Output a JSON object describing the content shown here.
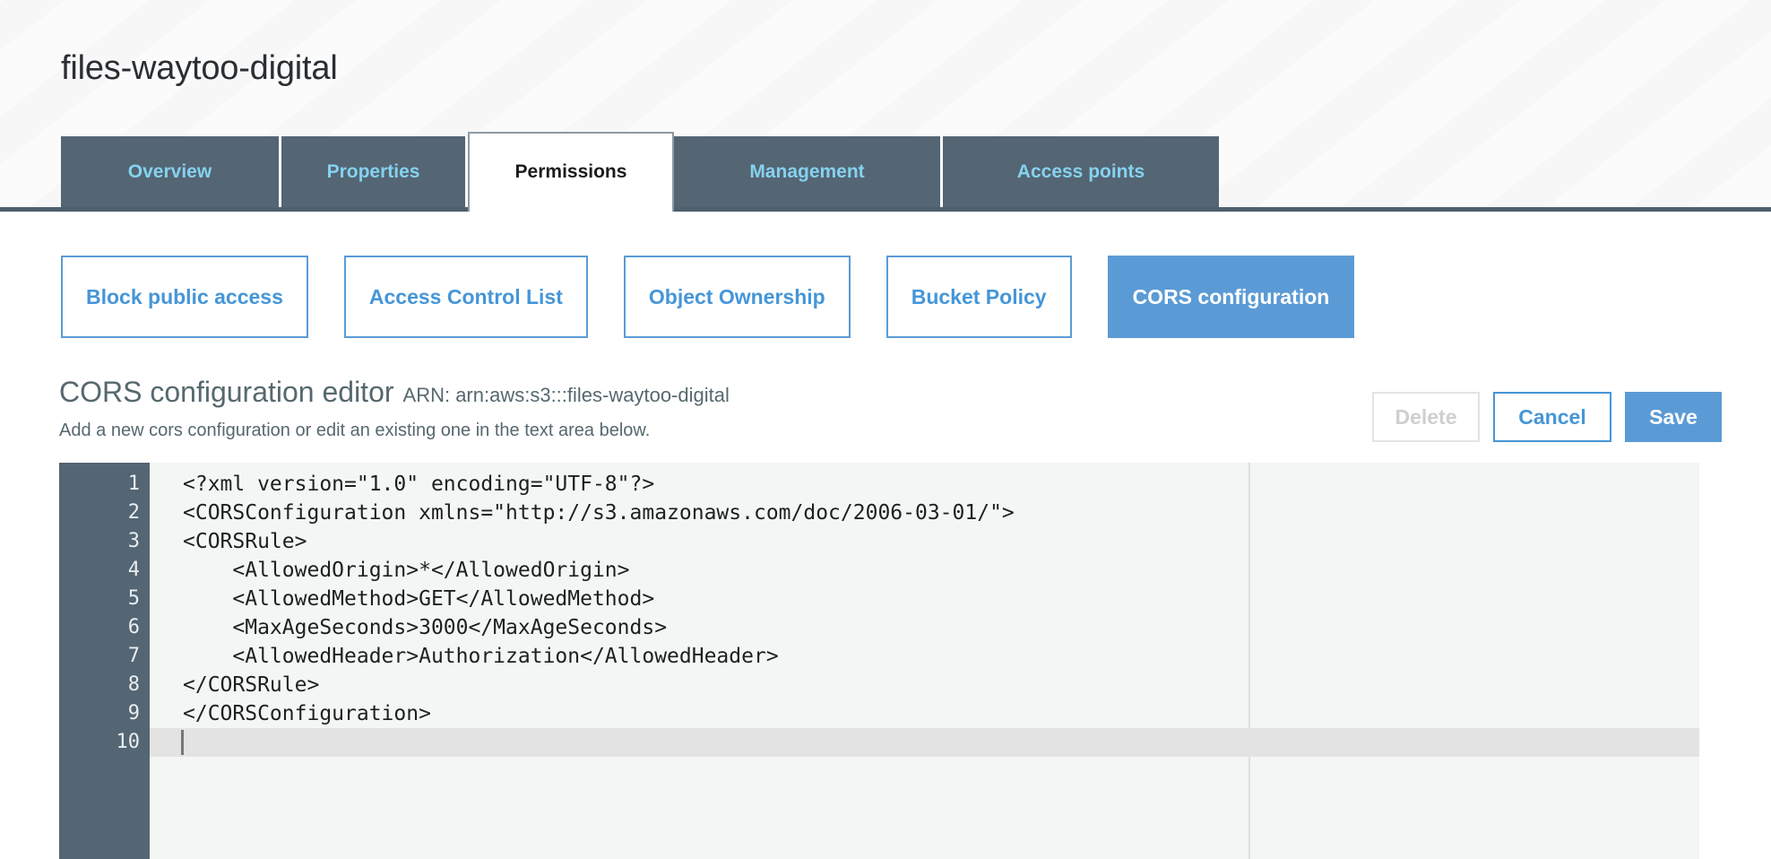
{
  "header": {
    "bucket_title": "files-waytoo-digital"
  },
  "tabs": [
    {
      "label": "Overview",
      "active": false,
      "width_class": "w1"
    },
    {
      "label": "Properties",
      "active": false,
      "width_class": "w2"
    },
    {
      "label": "Permissions",
      "active": true,
      "width_class": "w3"
    },
    {
      "label": "Management",
      "active": false,
      "width_class": "w4"
    },
    {
      "label": "Access points",
      "active": false,
      "width_class": "w5"
    }
  ],
  "subnav": [
    {
      "label": "Block public access",
      "selected": false
    },
    {
      "label": "Access Control List",
      "selected": false
    },
    {
      "label": "Object Ownership",
      "selected": false
    },
    {
      "label": "Bucket Policy",
      "selected": false
    },
    {
      "label": "CORS configuration",
      "selected": true
    }
  ],
  "editor_header": {
    "title": "CORS configuration editor",
    "arn": "ARN: arn:aws:s3:::files-waytoo-digital",
    "subtitle": "Add a new cors configuration or edit an existing one in the text area below."
  },
  "actions": {
    "delete_label": "Delete",
    "cancel_label": "Cancel",
    "save_label": "Save"
  },
  "code_editor": {
    "active_line": 10,
    "cursor_line": 10,
    "lines": [
      {
        "n": "1",
        "text": "<?xml version=\"1.0\" encoding=\"UTF-8\"?>"
      },
      {
        "n": "2",
        "text": "<CORSConfiguration xmlns=\"http://s3.amazonaws.com/doc/2006-03-01/\">"
      },
      {
        "n": "3",
        "text": "<CORSRule>"
      },
      {
        "n": "4",
        "text": "    <AllowedOrigin>*</AllowedOrigin>"
      },
      {
        "n": "5",
        "text": "    <AllowedMethod>GET</AllowedMethod>"
      },
      {
        "n": "6",
        "text": "    <MaxAgeSeconds>3000</MaxAgeSeconds>"
      },
      {
        "n": "7",
        "text": "    <AllowedHeader>Authorization</AllowedHeader>"
      },
      {
        "n": "8",
        "text": "</CORSRule>"
      },
      {
        "n": "9",
        "text": "</CORSConfiguration>"
      },
      {
        "n": "10",
        "text": ""
      }
    ]
  },
  "colors": {
    "tab_inactive_bg": "#546573",
    "tab_inactive_text": "#85d2ef",
    "accent_blue": "#5b9bd5",
    "link_blue": "#4596d8",
    "gutter_bg": "#546573",
    "editor_bg": "#f4f6f6",
    "active_line_bg": "#e3e3e3",
    "heading_gray": "#56686e"
  }
}
